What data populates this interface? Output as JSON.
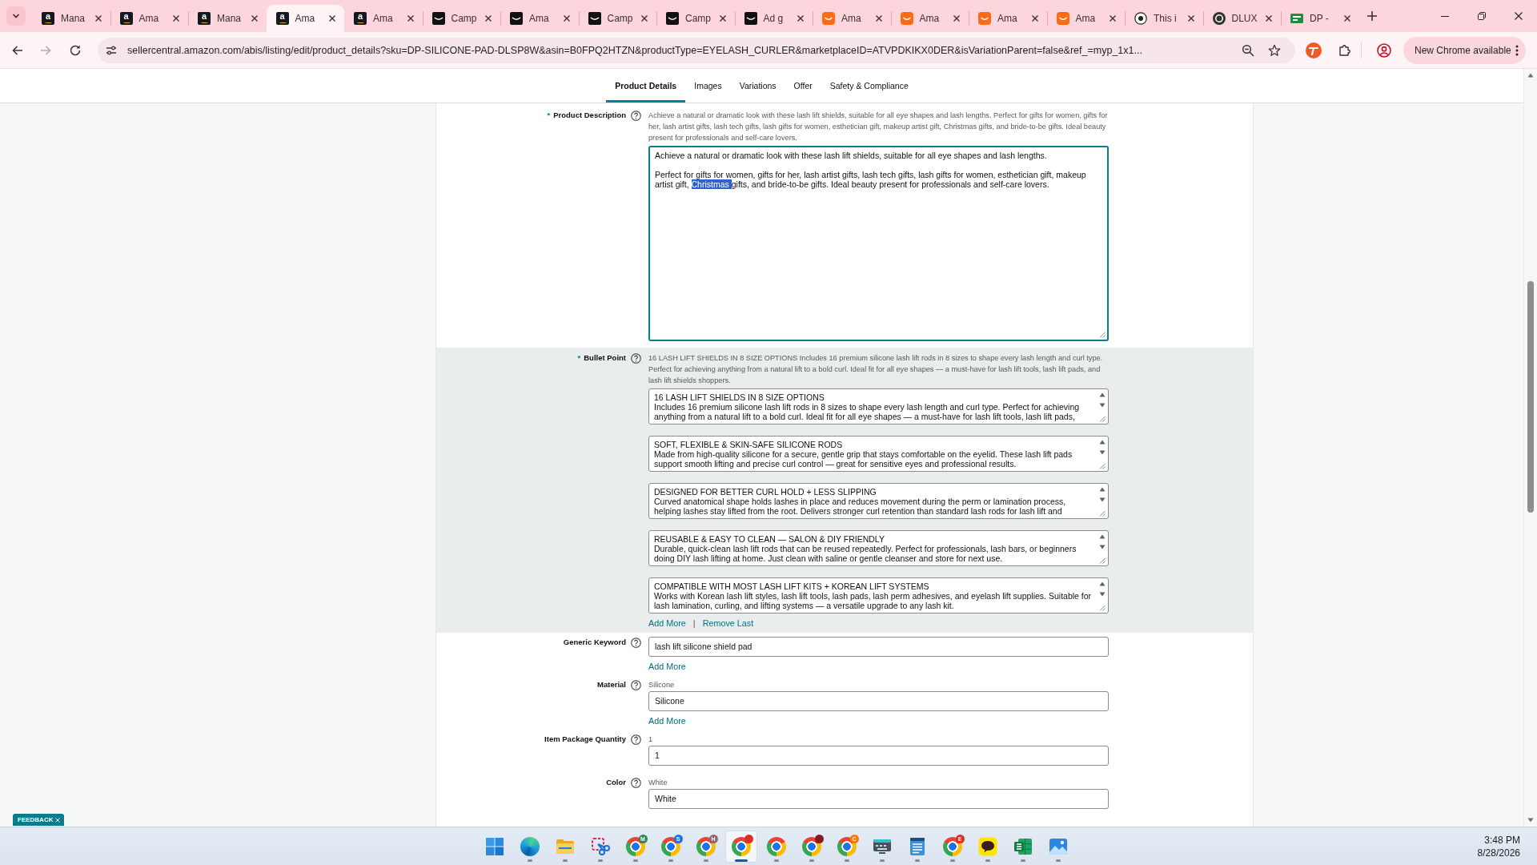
{
  "browser": {
    "tabs": [
      {
        "title": "Mana",
        "favicon": {
          "kind": "letter",
          "letter": "a"
        },
        "selected": false
      },
      {
        "title": "Ama",
        "favicon": {
          "kind": "letter",
          "letter": "a"
        },
        "selected": false
      },
      {
        "title": "Mana",
        "favicon": {
          "kind": "letter",
          "letter": "a"
        },
        "selected": false
      },
      {
        "title": "Ama",
        "favicon": {
          "kind": "letter",
          "letter": "a"
        },
        "selected": true
      },
      {
        "title": "Ama",
        "favicon": {
          "kind": "letter",
          "letter": "a"
        },
        "selected": false
      },
      {
        "title": "Camp",
        "favicon": {
          "kind": "smile_dark"
        },
        "selected": false
      },
      {
        "title": "Ama",
        "favicon": {
          "kind": "smile_dark"
        },
        "selected": false
      },
      {
        "title": "Camp",
        "favicon": {
          "kind": "smile_dark"
        },
        "selected": false
      },
      {
        "title": "Camp",
        "favicon": {
          "kind": "smile_dark"
        },
        "selected": false
      },
      {
        "title": "Ad g",
        "favicon": {
          "kind": "smile_dark"
        },
        "selected": false
      },
      {
        "title": "Ama",
        "favicon": {
          "kind": "smile_orange"
        },
        "selected": false
      },
      {
        "title": "Ama",
        "favicon": {
          "kind": "smile_orange"
        },
        "selected": false
      },
      {
        "title": "Ama",
        "favicon": {
          "kind": "smile_orange"
        },
        "selected": false
      },
      {
        "title": "Ama",
        "favicon": {
          "kind": "smile_orange"
        },
        "selected": false
      },
      {
        "title": "This i",
        "favicon": {
          "kind": "eye"
        },
        "selected": false
      },
      {
        "title": "DLUX",
        "favicon": {
          "kind": "dial"
        },
        "selected": false
      },
      {
        "title": "DP -",
        "favicon": {
          "kind": "sheet"
        },
        "selected": false
      }
    ],
    "address": "sellercentral.amazon.com/abis/listing/edit/product_details?sku=DP-SILICONE-PAD-DLSP8W&asin=B0FPQ2HTZN&productType=EYELASH_CURLER&marketplaceID=ATVPDKIKX0DER&isVariationParent=false&ref_=myp_1x1...",
    "update_button": "New Chrome available"
  },
  "page_tabs": [
    {
      "label": "Product Details",
      "selected": true
    },
    {
      "label": "Images",
      "selected": false
    },
    {
      "label": "Variations",
      "selected": false
    },
    {
      "label": "Offer",
      "selected": false
    },
    {
      "label": "Safety & Compliance",
      "selected": false
    }
  ],
  "fields": [
    {
      "kind": "textarea",
      "required_mark": "*",
      "label": "Product Description",
      "highlighted": false,
      "hint": "Achieve a natural or dramatic look with these lash lift shields, suitable for all eye shapes and lash lengths. Perfect for gifts for women, gifts for her, lash artist gifts, lash tech gifts, lash gifts for women, esthetician gift, makeup artist gift, Christmas gifts, and bride-to-be gifts. Ideal beauty present for professionals and self-care lovers.",
      "focused": true,
      "paragraphs": [
        [
          {
            "text": "Achieve a natural or dramatic look with these lash lift shields, suitable for all eye shapes and lash lengths.",
            "selected": false
          }
        ],
        [
          {
            "text": "Perfect for gifts for women, gifts for her, lash artist gifts, lash tech gifts, lash gifts for women, esthetician gift, makeup artist gift, ",
            "selected": false
          },
          {
            "text": "Christmas ",
            "selected": true
          },
          {
            "text": "gifts, and bride-to-be gifts. Ideal beauty present for professionals and self-care lovers.",
            "selected": false
          }
        ]
      ]
    },
    {
      "kind": "textarea_list",
      "required_mark": "*",
      "label": "Bullet Point",
      "highlighted": true,
      "hint": "16 LASH LIFT SHIELDS IN 8 SIZE OPTIONS Includes 16 premium silicone lash lift rods in 8 sizes to shape every lash length and curl type. Perfect for achieving anything from a natural lift to a bold curl. Ideal fit for all eye shapes — a must-have for lash lift tools, lash lift pads, and lash lift shields shoppers.",
      "values": [
        "16 LASH LIFT SHIELDS IN 8 SIZE OPTIONS\nIncludes 16 premium silicone lash lift rods in 8 sizes to shape every lash length and curl type. Perfect for achieving anything from a natural lift to a bold curl. Ideal fit for all eye shapes — a must-have for lash lift tools, lash lift pads,",
        "SOFT, FLEXIBLE & SKIN-SAFE SILICONE RODS\nMade from high-quality silicone for a secure, gentle grip that stays comfortable on the eyelid. These lash lift pads support smooth lifting and precise curl control — great for sensitive eyes and professional results.",
        "DESIGNED FOR BETTER CURL HOLD + LESS SLIPPING\nCurved anatomical shape holds lashes in place and reduces movement during the perm or lamination process, helping lashes stay lifted from the root. Delivers stronger curl retention than standard lash rods for lash lift and",
        "REUSABLE & EASY TO CLEAN — SALON & DIY FRIENDLY\nDurable, quick-clean lash lift rods that can be reused repeatedly. Perfect for professionals, lash bars, or beginners doing DIY lash lifting at home. Just clean with saline or gentle cleanser and store for next use.",
        "COMPATIBLE WITH MOST LASH LIFT KITS + KOREAN LIFT SYSTEMS\nWorks with Korean lash lift styles, lash lift tools, lash pads, lash perm adhesives, and eyelash lift supplies. Suitable for lash lamination, curling, and lifting systems — a versatile upgrade to any lash kit."
      ],
      "links": [
        "Add More",
        "Remove Last"
      ],
      "link_separator": "|"
    },
    {
      "kind": "input_list",
      "label": "Generic Keyword",
      "highlighted": false,
      "values": [
        "lash lift silicone shield pad"
      ],
      "links": [
        "Add More"
      ]
    },
    {
      "kind": "input_list",
      "label": "Material",
      "highlighted": false,
      "hint": "Silicone",
      "values": [
        "Silicone"
      ],
      "links": [
        "Add More"
      ]
    },
    {
      "kind": "input_list",
      "label": "Item Package Quantity",
      "highlighted": false,
      "hint": "1",
      "values": [
        "1"
      ]
    },
    {
      "kind": "input_list",
      "label": "Color",
      "highlighted": false,
      "hint": "White",
      "values": [
        "White"
      ]
    }
  ],
  "feedback": {
    "label": "FEEDBACK"
  },
  "taskbar": {
    "apps": [
      {
        "kind": "start",
        "running": false,
        "selected": false
      },
      {
        "kind": "edge",
        "running": true,
        "selected": false
      },
      {
        "kind": "folder",
        "running": true,
        "selected": false
      },
      {
        "kind": "snip",
        "running": true,
        "selected": false
      },
      {
        "kind": "chrome",
        "running": true,
        "selected": false,
        "badge": {
          "letter": "M",
          "color": "#2e8b57"
        }
      },
      {
        "kind": "chrome",
        "running": true,
        "selected": false,
        "badge": {
          "letter": "S",
          "color": "#1a73e8"
        }
      },
      {
        "kind": "chrome",
        "running": true,
        "selected": false,
        "badge": {
          "letter": "H",
          "color": "#8d6e63"
        }
      },
      {
        "kind": "chrome",
        "running": true,
        "selected": true,
        "badge": {
          "color": "#d93025"
        }
      },
      {
        "kind": "chrome",
        "running": true,
        "selected": false
      },
      {
        "kind": "chrome",
        "running": true,
        "selected": false,
        "badge": {
          "color": "#8b1a1a"
        }
      },
      {
        "kind": "chrome",
        "running": true,
        "selected": false,
        "badge": {
          "letter": "C",
          "color": "#f57c00"
        }
      },
      {
        "kind": "keyboard",
        "running": true,
        "selected": false
      },
      {
        "kind": "notepad",
        "running": true,
        "selected": false
      },
      {
        "kind": "chrome",
        "running": true,
        "selected": false,
        "badge": {
          "letter": "E",
          "color": "#d93025"
        }
      },
      {
        "kind": "chat",
        "running": true,
        "selected": false
      },
      {
        "kind": "excel",
        "running": true,
        "selected": false
      },
      {
        "kind": "photos",
        "running": true,
        "selected": false
      }
    ],
    "time": "3:48 PM",
    "date": "8/28/2026"
  }
}
